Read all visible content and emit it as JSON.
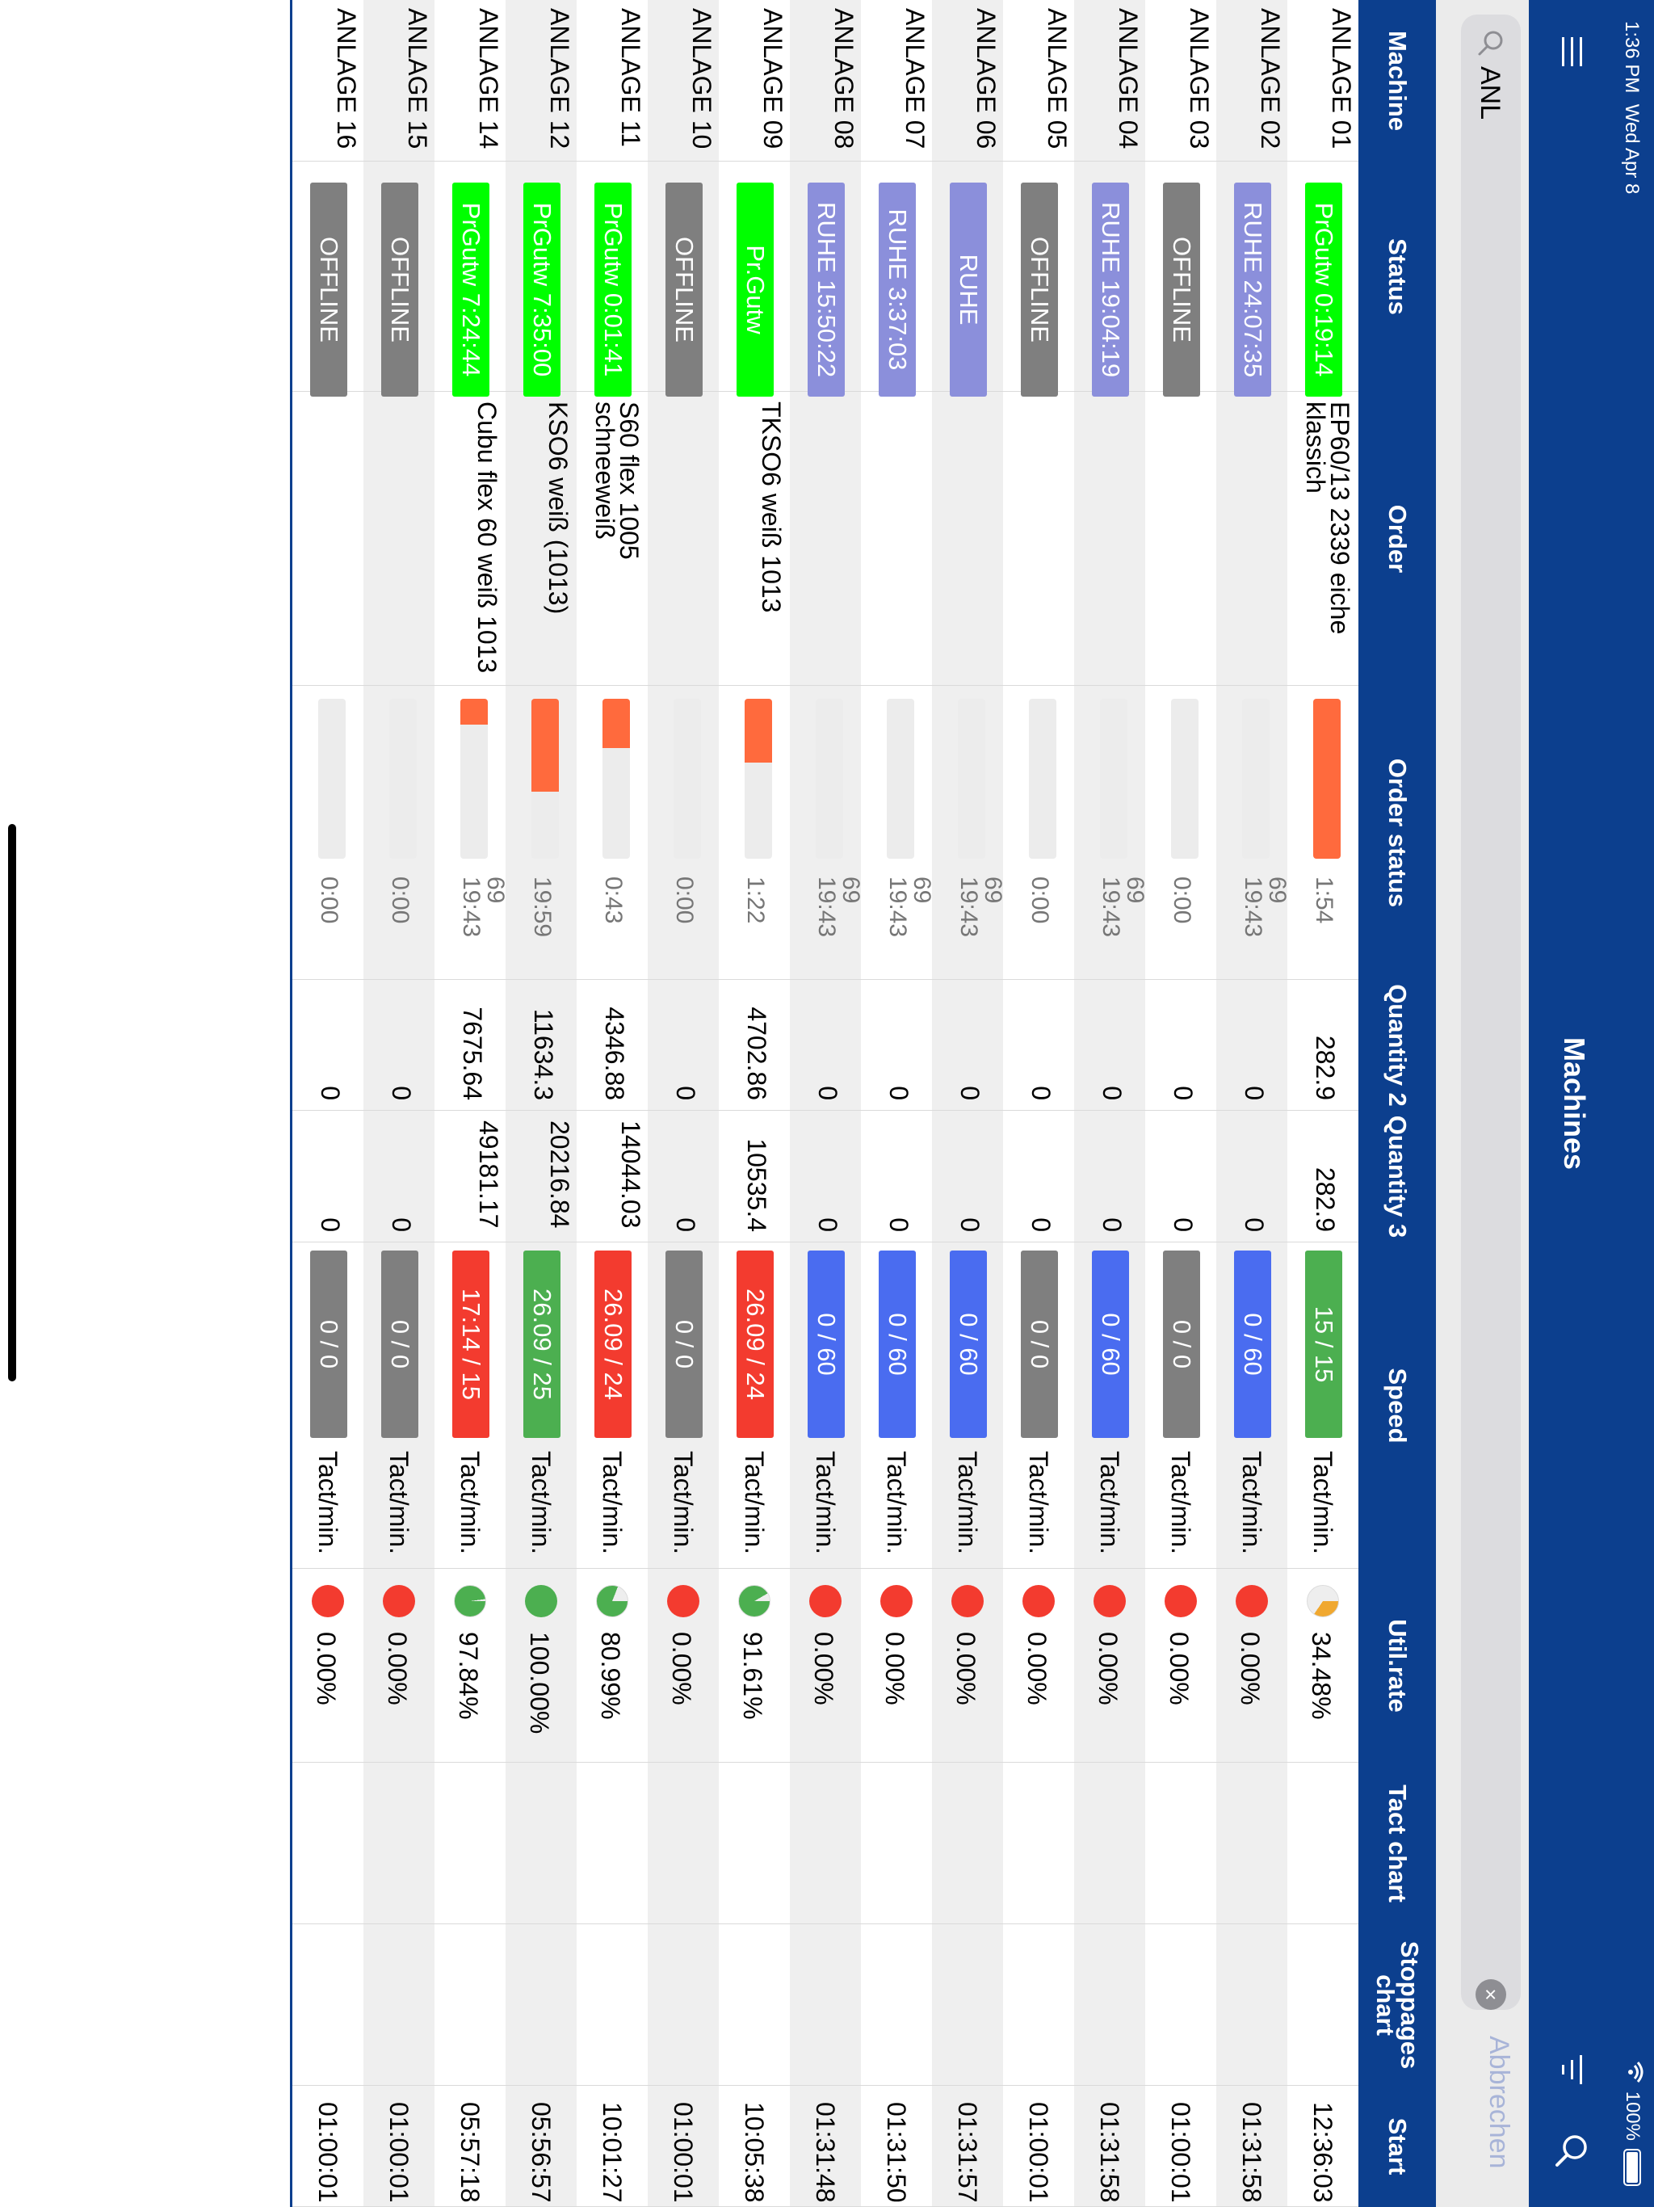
{
  "status_bar": {
    "time": "1:36 PM",
    "date": "Wed Apr 8",
    "battery": "100%"
  },
  "nav": {
    "title": "Machines",
    "menu_icon": "hamburger-menu-icon",
    "filter_icon": "filter-icon",
    "search_icon": "search-icon"
  },
  "search": {
    "value": "ANL",
    "cancel_label": "Abbrechen"
  },
  "columns": [
    "Machine",
    "Status",
    "Order",
    "Order status",
    "Quantity 2",
    "Quantity 3",
    "Speed",
    "Util.rate",
    "Tact chart",
    "Stoppages chart",
    "Start"
  ],
  "speed_unit": "Tact/min.",
  "colors": {
    "header_bg": "#0c3f8e",
    "prgutw": "#00ff00",
    "ruhe": "#8b8fdb",
    "offline": "#7f7f7f",
    "speed_green": "#4caf50",
    "speed_blue": "#4a6cf0",
    "speed_red": "#f33b2f",
    "speed_gray": "#7f7f7f",
    "order_bar": "#ff6a3d",
    "util_red": "#f33b2f",
    "util_green": "#4caf50",
    "util_orange": "#f0a830"
  },
  "rows": [
    {
      "machine": "ANLAGE 01",
      "status": "PrGutw  0:19:14",
      "status_type": "prgutw",
      "order": "EP60/13 2339 eiche klassich",
      "order_progress": 1.0,
      "order_status": "1:54",
      "qty2": "282.9",
      "qty3": "282.9",
      "speed": "15 / 15",
      "speed_type": "green",
      "util": "34.48%",
      "util_fraction": 0.3448,
      "util_type": "orange",
      "start": "12:36:03"
    },
    {
      "machine": "ANLAGE 02",
      "status": "RUHE  24:07:35",
      "status_type": "ruhe",
      "order": "",
      "order_progress": 0,
      "order_status": "69 19:43",
      "qty2": "0",
      "qty3": "0",
      "speed": "0 / 60",
      "speed_type": "blue",
      "util": "0.00%",
      "util_fraction": 0,
      "util_type": "red",
      "start": "01:31:58"
    },
    {
      "machine": "ANLAGE 03",
      "status": "OFFLINE",
      "status_type": "offline",
      "order": "",
      "order_progress": 0,
      "order_status": "0:00",
      "qty2": "0",
      "qty3": "0",
      "speed": "0 / 0",
      "speed_type": "gray",
      "util": "0.00%",
      "util_fraction": 0,
      "util_type": "red",
      "start": "01:00:01"
    },
    {
      "machine": "ANLAGE 04",
      "status": "RUHE  19:04:19",
      "status_type": "ruhe",
      "order": "",
      "order_progress": 0,
      "order_status": "69 19:43",
      "qty2": "0",
      "qty3": "0",
      "speed": "0 / 60",
      "speed_type": "blue",
      "util": "0.00%",
      "util_fraction": 0,
      "util_type": "red",
      "start": "01:31:58"
    },
    {
      "machine": "ANLAGE 05",
      "status": "OFFLINE",
      "status_type": "offline",
      "order": "",
      "order_progress": 0,
      "order_status": "0:00",
      "qty2": "0",
      "qty3": "0",
      "speed": "0 / 0",
      "speed_type": "gray",
      "util": "0.00%",
      "util_fraction": 0,
      "util_type": "red",
      "start": "01:00:01"
    },
    {
      "machine": "ANLAGE 06",
      "status": "RUHE",
      "status_type": "ruhe",
      "order": "",
      "order_progress": 0,
      "order_status": "69 19:43",
      "qty2": "0",
      "qty3": "0",
      "speed": "0 / 60",
      "speed_type": "blue",
      "util": "0.00%",
      "util_fraction": 0,
      "util_type": "red",
      "start": "01:31:57"
    },
    {
      "machine": "ANLAGE 07",
      "status": "RUHE  3:37:03",
      "status_type": "ruhe",
      "order": "",
      "order_progress": 0,
      "order_status": "69 19:43",
      "qty2": "0",
      "qty3": "0",
      "speed": "0 / 60",
      "speed_type": "blue",
      "util": "0.00%",
      "util_fraction": 0,
      "util_type": "red",
      "start": "01:31:50"
    },
    {
      "machine": "ANLAGE 08",
      "status": "RUHE  15:50:22",
      "status_type": "ruhe",
      "order": "",
      "order_progress": 0,
      "order_status": "69 19:43",
      "qty2": "0",
      "qty3": "0",
      "speed": "0 / 60",
      "speed_type": "blue",
      "util": "0.00%",
      "util_fraction": 0,
      "util_type": "red",
      "start": "01:31:48"
    },
    {
      "machine": "ANLAGE 09",
      "status": "Pr.Gutw",
      "status_type": "prgutw",
      "order": "TKSO6 weiß 1013",
      "order_progress": 0.4,
      "order_status": "1:22",
      "qty2": "4702.86",
      "qty3": "10535.4",
      "speed": "26.09 / 24",
      "speed_type": "red",
      "util": "91.61%",
      "util_fraction": 0.9161,
      "util_type": "green",
      "start": "10:05:38"
    },
    {
      "machine": "ANLAGE 10",
      "status": "OFFLINE",
      "status_type": "offline",
      "order": "",
      "order_progress": 0,
      "order_status": "0:00",
      "qty2": "0",
      "qty3": "0",
      "speed": "0 / 0",
      "speed_type": "gray",
      "util": "0.00%",
      "util_fraction": 0,
      "util_type": "red",
      "start": "01:00:01"
    },
    {
      "machine": "ANLAGE 11",
      "status": "PrGutw  0:01:41",
      "status_type": "prgutw",
      "order": "S60 flex 1005 schneeweiß",
      "order_progress": 0.31,
      "order_status": "0:43",
      "qty2": "4346.88",
      "qty3": "14044.03",
      "speed": "26.09 / 24",
      "speed_type": "red",
      "util": "80.99%",
      "util_fraction": 0.8099,
      "util_type": "green",
      "start": "10:01:27"
    },
    {
      "machine": "ANLAGE 12",
      "status": "PrGutw  7:35:00",
      "status_type": "prgutw",
      "order": "KSO6 weiß (1013)",
      "order_progress": 0.58,
      "order_status": "19:59",
      "qty2": "11634.3",
      "qty3": "20216.84",
      "speed": "26.09 / 25",
      "speed_type": "green",
      "util": "100.00%",
      "util_fraction": 1.0,
      "util_type": "green",
      "start": "05:56:57"
    },
    {
      "machine": "ANLAGE 14",
      "status": "PrGutw  7:24:44",
      "status_type": "prgutw",
      "order": "Cubu flex 60 weiß 1013",
      "order_progress": 0.16,
      "order_status": "69 19:43",
      "qty2": "7675.64",
      "qty3": "49181.17",
      "speed": "17:14 / 15",
      "speed_type": "red",
      "util": "97.84%",
      "util_fraction": 0.9784,
      "util_type": "green",
      "start": "05:57:18"
    },
    {
      "machine": "ANLAGE 15",
      "status": "OFFLINE",
      "status_type": "offline",
      "order": "",
      "order_progress": 0,
      "order_status": "0:00",
      "qty2": "0",
      "qty3": "0",
      "speed": "0 / 0",
      "speed_type": "gray",
      "util": "0.00%",
      "util_fraction": 0,
      "util_type": "red",
      "start": "01:00:01"
    },
    {
      "machine": "ANLAGE 16",
      "status": "OFFLINE",
      "status_type": "offline",
      "order": "",
      "order_progress": 0,
      "order_status": "0:00",
      "qty2": "0",
      "qty3": "0",
      "speed": "0 / 0",
      "speed_type": "gray",
      "util": "0.00%",
      "util_fraction": 0,
      "util_type": "red",
      "start": "01:00:01"
    }
  ]
}
